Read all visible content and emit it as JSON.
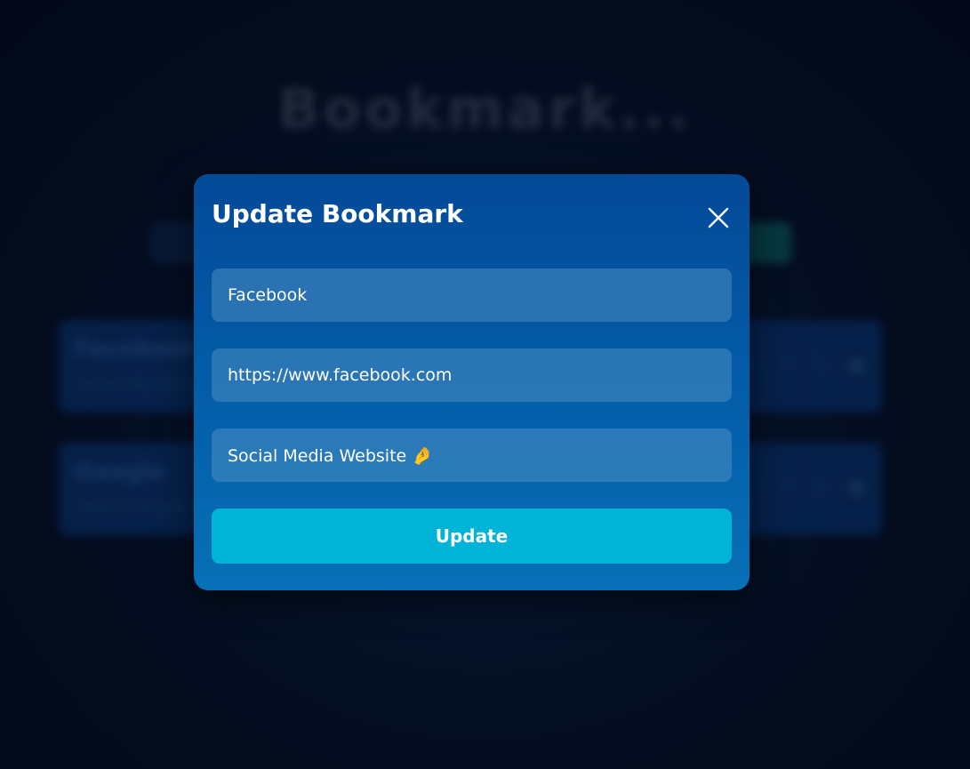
{
  "background": {
    "title": "Bookmark...",
    "cards": [
      {
        "name": "Facebook",
        "description": "Social Media Website"
      },
      {
        "name": "Google",
        "description": "Search Engine"
      }
    ],
    "action_icons": [
      "share-icon",
      "edit-icon",
      "delete-icon"
    ]
  },
  "modal": {
    "title": "Update Bookmark",
    "close_icon": "close-icon",
    "name_value": "Facebook",
    "url_value": "https://www.facebook.com",
    "description_value": "Social Media Website 🤌",
    "submit_label": "Update"
  },
  "colors": {
    "accent": "#00b4d8",
    "modal_top": "#044a98",
    "modal_bottom": "#0770b6",
    "page_background": "#040d20"
  }
}
